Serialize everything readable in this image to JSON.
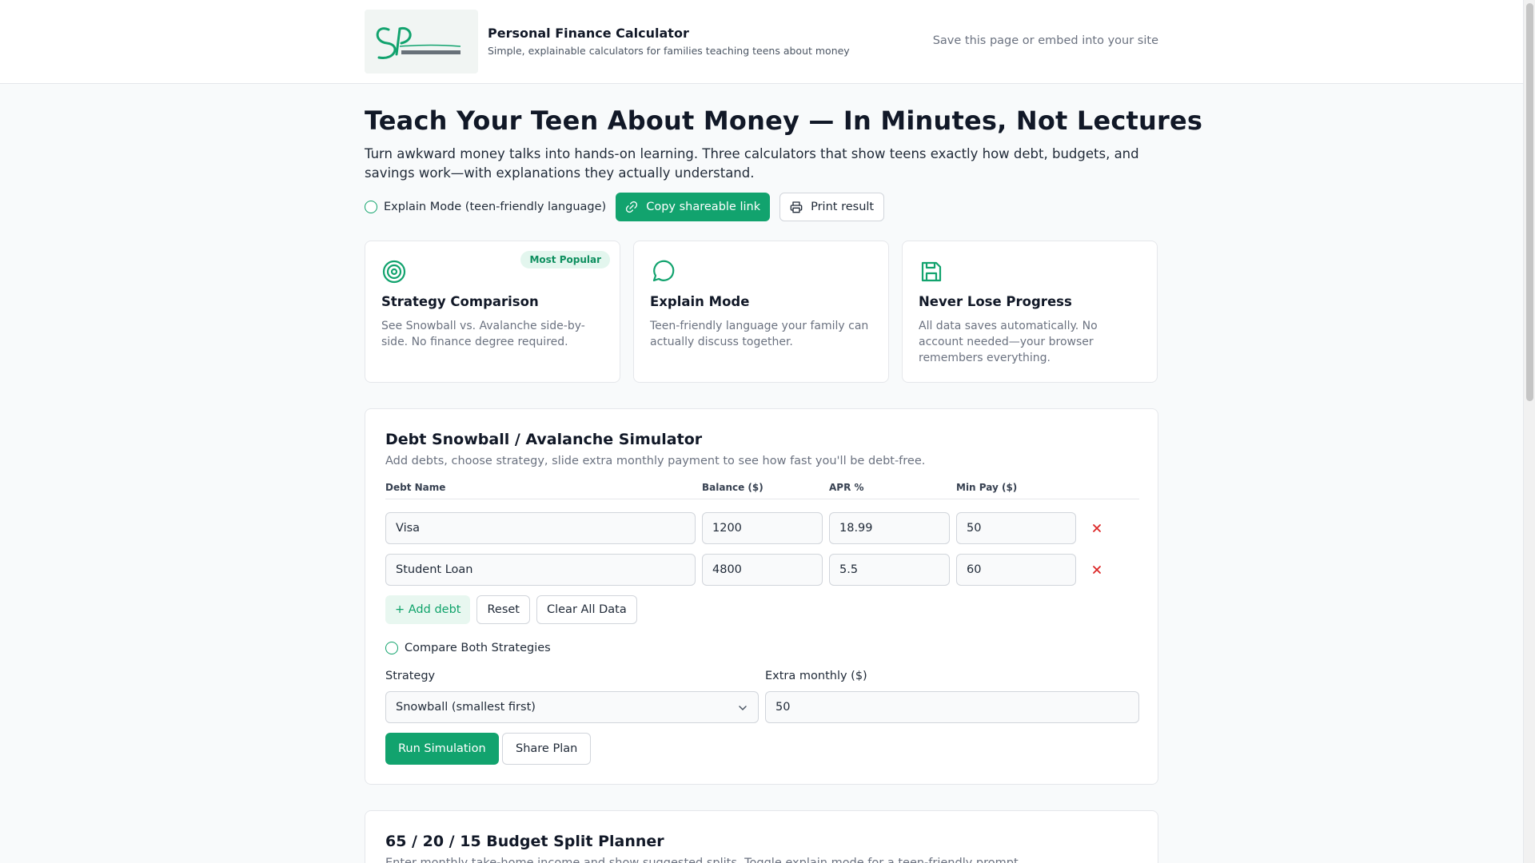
{
  "header": {
    "logo_icon": "steady-plodding-logo",
    "title": "Personal Finance Calculator",
    "subtitle": "Simple, explainable calculators for families teaching teens about money",
    "save_link": "Save this page or embed into your site"
  },
  "hero": {
    "title": "Teach Your Teen About Money — In Minutes, Not Lectures",
    "description": "Turn awkward money talks into hands-on learning. Three calculators that show teens exactly how debt, budgets, and savings work—with explanations they actually understand."
  },
  "toolbar": {
    "explain_label": "Explain Mode (teen-friendly language)",
    "copy_link_label": "Copy shareable link",
    "print_label": "Print result"
  },
  "features": [
    {
      "icon": "target-icon",
      "badge": "Most Popular",
      "title": "Strategy Comparison",
      "desc": "See Snowball vs. Avalanche side-by-side. No finance degree required."
    },
    {
      "icon": "chat-bubble-icon",
      "title": "Explain Mode",
      "desc": "Teen-friendly language your family can actually discuss together."
    },
    {
      "icon": "save-icon",
      "title": "Never Lose Progress",
      "desc": "All data saves automatically. No account needed—your browser remembers everything."
    }
  ],
  "debt_panel": {
    "title": "Debt Snowball / Avalanche Simulator",
    "subtitle": "Add debts, choose strategy, slide extra monthly payment to see how fast you'll be debt-free.",
    "columns": [
      "Debt Name",
      "Balance ($)",
      "APR %",
      "Min Pay ($)"
    ],
    "rows": [
      {
        "name": "Visa",
        "balance": "1200",
        "apr": "18.99",
        "min_pay": "50"
      },
      {
        "name": "Student Loan",
        "balance": "4800",
        "apr": "5.5",
        "min_pay": "60"
      }
    ],
    "add_label": "+ Add debt",
    "reset_label": "Reset",
    "clear_label": "Clear All Data",
    "compare_label": "Compare Both Strategies",
    "strategy_label": "Strategy",
    "strategy_value": "Snowball (smallest first)",
    "extra_label": "Extra monthly ($)",
    "extra_value": "50",
    "run_label": "Run Simulation",
    "share_label": "Share Plan"
  },
  "budget_panel": {
    "title": "65 / 20 / 15 Budget Split Planner",
    "subtitle": "Enter monthly take-home income and show suggested splits. Toggle explain mode for a teen-friendly prompt."
  },
  "colors": {
    "accent": "#12a36e",
    "danger": "#dc2626"
  }
}
